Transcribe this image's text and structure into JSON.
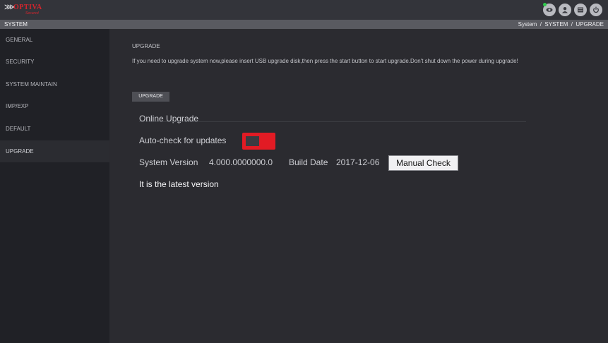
{
  "brand": {
    "mark": "⋙",
    "name": "OPTIVA",
    "subtitle": "Secured"
  },
  "top_icons": [
    {
      "name": "live-view-icon",
      "status_color": "#2ecb4b"
    },
    {
      "name": "user-icon"
    },
    {
      "name": "menu-grid-icon"
    },
    {
      "name": "power-icon"
    }
  ],
  "header": {
    "title": "SYSTEM",
    "breadcrumb": "System  /  SYSTEM  /  UPGRADE"
  },
  "sidebar": {
    "items": [
      {
        "label": "GENERAL",
        "active": false
      },
      {
        "label": "SECURITY",
        "active": false
      },
      {
        "label": "SYSTEM MAINTAIN",
        "active": false
      },
      {
        "label": "IMP/EXP",
        "active": false
      },
      {
        "label": "DEFAULT",
        "active": false
      },
      {
        "label": "UPGRADE",
        "active": true
      }
    ]
  },
  "main": {
    "section_title": "UPGRADE",
    "notice": "If you need to upgrade system now,please insert USB upgrade disk,then press the start button to start upgrade.Don't shut down the power during upgrade!",
    "upgrade_button": "UPGRADE",
    "online": {
      "title": "Online Upgrade",
      "auto_check_label": "Auto-check for updates",
      "auto_check_enabled": false,
      "toggle_color": "#e21b24",
      "system_version_label": "System Version",
      "system_version": "4.000.0000000.0",
      "build_date_label": "Build Date",
      "build_date": "2017-12-06",
      "manual_check_button": "Manual Check",
      "status": "It is the latest version"
    }
  }
}
